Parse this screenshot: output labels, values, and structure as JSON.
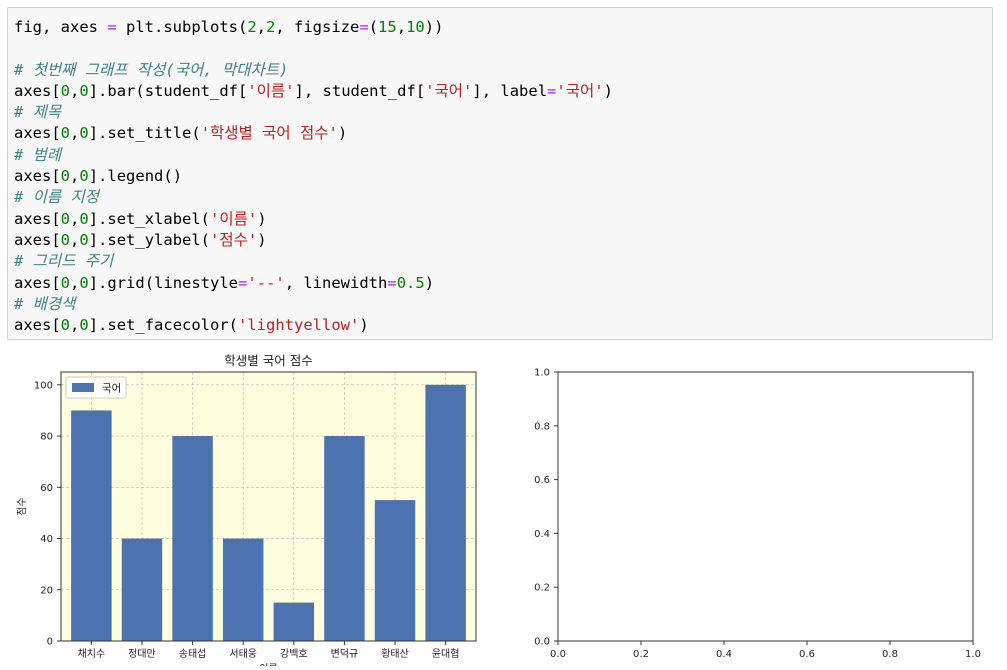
{
  "code_cell": {
    "lines": [
      [
        {
          "t": "fig, axes ",
          "c": ""
        },
        {
          "t": "=",
          "c": "op"
        },
        {
          "t": " plt.subplots(",
          "c": ""
        },
        {
          "t": "2",
          "c": "num"
        },
        {
          "t": ",",
          "c": ""
        },
        {
          "t": "2",
          "c": "num"
        },
        {
          "t": ", figsize",
          "c": ""
        },
        {
          "t": "=",
          "c": "op"
        },
        {
          "t": "(",
          "c": ""
        },
        {
          "t": "15",
          "c": "num"
        },
        {
          "t": ",",
          "c": ""
        },
        {
          "t": "10",
          "c": "num"
        },
        {
          "t": "))",
          "c": ""
        }
      ],
      [],
      [
        {
          "t": "# 첫번째 그래프 작성(국어, 막대차트)",
          "c": "comment"
        }
      ],
      [
        {
          "t": "axes[",
          "c": ""
        },
        {
          "t": "0",
          "c": "num"
        },
        {
          "t": ",",
          "c": ""
        },
        {
          "t": "0",
          "c": "num"
        },
        {
          "t": "].bar(student_df[",
          "c": ""
        },
        {
          "t": "'이름'",
          "c": "str"
        },
        {
          "t": "], student_df[",
          "c": ""
        },
        {
          "t": "'국어'",
          "c": "str"
        },
        {
          "t": "], label",
          "c": ""
        },
        {
          "t": "=",
          "c": "op"
        },
        {
          "t": "'국어'",
          "c": "str"
        },
        {
          "t": ")",
          "c": ""
        }
      ],
      [
        {
          "t": "# 제목",
          "c": "comment"
        }
      ],
      [
        {
          "t": "axes[",
          "c": ""
        },
        {
          "t": "0",
          "c": "num"
        },
        {
          "t": ",",
          "c": ""
        },
        {
          "t": "0",
          "c": "num"
        },
        {
          "t": "].set_title(",
          "c": ""
        },
        {
          "t": "'학생별 국어 점수'",
          "c": "str"
        },
        {
          "t": ")",
          "c": ""
        }
      ],
      [
        {
          "t": "# 범례",
          "c": "comment"
        }
      ],
      [
        {
          "t": "axes[",
          "c": ""
        },
        {
          "t": "0",
          "c": "num"
        },
        {
          "t": ",",
          "c": ""
        },
        {
          "t": "0",
          "c": "num"
        },
        {
          "t": "].legend()",
          "c": ""
        }
      ],
      [
        {
          "t": "# 이름 지정",
          "c": "comment"
        }
      ],
      [
        {
          "t": "axes[",
          "c": ""
        },
        {
          "t": "0",
          "c": "num"
        },
        {
          "t": ",",
          "c": ""
        },
        {
          "t": "0",
          "c": "num"
        },
        {
          "t": "].set_xlabel(",
          "c": ""
        },
        {
          "t": "'이름'",
          "c": "str"
        },
        {
          "t": ")",
          "c": ""
        }
      ],
      [
        {
          "t": "axes[",
          "c": ""
        },
        {
          "t": "0",
          "c": "num"
        },
        {
          "t": ",",
          "c": ""
        },
        {
          "t": "0",
          "c": "num"
        },
        {
          "t": "].set_ylabel(",
          "c": ""
        },
        {
          "t": "'점수'",
          "c": "str"
        },
        {
          "t": ")",
          "c": ""
        }
      ],
      [
        {
          "t": "# 그리드 주기",
          "c": "comment"
        }
      ],
      [
        {
          "t": "axes[",
          "c": ""
        },
        {
          "t": "0",
          "c": "num"
        },
        {
          "t": ",",
          "c": ""
        },
        {
          "t": "0",
          "c": "num"
        },
        {
          "t": "].grid(linestyle",
          "c": ""
        },
        {
          "t": "=",
          "c": "op"
        },
        {
          "t": "'--'",
          "c": "str"
        },
        {
          "t": ", linewidth",
          "c": ""
        },
        {
          "t": "=",
          "c": "op"
        },
        {
          "t": "0.5",
          "c": "num"
        },
        {
          "t": ")",
          "c": ""
        }
      ],
      [
        {
          "t": "# 배경색",
          "c": "comment"
        }
      ],
      [
        {
          "t": "axes[",
          "c": ""
        },
        {
          "t": "0",
          "c": "num"
        },
        {
          "t": ",",
          "c": ""
        },
        {
          "t": "0",
          "c": "num"
        },
        {
          "t": "].set_facecolor(",
          "c": ""
        },
        {
          "t": "'lightyellow'",
          "c": "str"
        },
        {
          "t": ")",
          "c": ""
        }
      ]
    ]
  },
  "chart_data": [
    {
      "type": "bar",
      "title": "학생별 국어 점수",
      "xlabel": "이름",
      "ylabel": "점수",
      "categories": [
        "채치수",
        "정대만",
        "송태섭",
        "서태웅",
        "강백호",
        "변덕규",
        "황태산",
        "윤대협"
      ],
      "series": [
        {
          "name": "국어",
          "values": [
            90,
            40,
            80,
            40,
            15,
            80,
            55,
            100
          ]
        }
      ],
      "ylim": [
        0,
        105
      ],
      "yticks": [
        "0",
        "20",
        "40",
        "60",
        "80",
        "100"
      ],
      "grid": true,
      "legend": "top-left",
      "facecolor": "#ffffe0",
      "bar_color": "#4c72b0"
    },
    {
      "type": "scatter",
      "title": "",
      "xlabel": "",
      "ylabel": "",
      "xlim": [
        0,
        1
      ],
      "ylim": [
        0,
        1
      ],
      "xticks": [
        "0.0",
        "0.2",
        "0.4",
        "0.6",
        "0.8",
        "1.0"
      ],
      "yticks": [
        "0.0",
        "0.2",
        "0.4",
        "0.6",
        "0.8",
        "1.0"
      ],
      "grid": false,
      "series": []
    }
  ]
}
